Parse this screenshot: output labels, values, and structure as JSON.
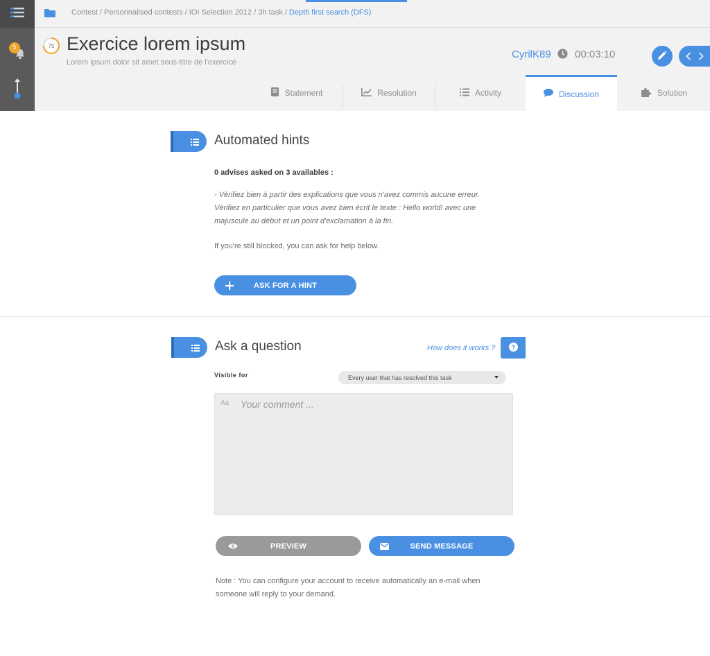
{
  "sidebar": {
    "notifications_count": "5"
  },
  "breadcrumb": {
    "items": [
      "Contest",
      "Personnalised contests",
      "IOI Selection 2012",
      "3h task"
    ],
    "current": "Depth first search (DFS)",
    "separator": "/"
  },
  "header": {
    "score": "75",
    "title": "Exercice lorem ipsum",
    "subtitle": "Lorem ipsum dolor sit amet sous-titre de l'exercice",
    "username": "CyrilK89",
    "timer": "00:03:10"
  },
  "tabs": [
    {
      "label": "Statement",
      "icon": "book-icon"
    },
    {
      "label": "Resolution",
      "icon": "chart-icon"
    },
    {
      "label": "Activity",
      "icon": "list-icon"
    },
    {
      "label": "Discussion",
      "icon": "comment-icon",
      "active": true
    },
    {
      "label": "Solution",
      "icon": "puzzle-icon"
    }
  ],
  "hints": {
    "title": "Automated hints",
    "count_line": "0 advises asked on 3 availables :",
    "hint_text": "- Vérifiez bien à partir des explications que vous n'avez commis aucune erreur. Vérifiez en particulier que vous avez bien écrit le texte : Hello world! avec une majuscule au début et un point d'exclamation à la fin.",
    "still_blocked": "If you're still blocked, you can ask for help below.",
    "ask_button": "ASK FOR A HINT"
  },
  "question": {
    "title": "Ask a question",
    "how_link": "How does it works ?",
    "visible_label": "Visible for",
    "visible_value": "Every user that has resolved this task",
    "editor_label": "Aa",
    "comment_placeholder": "Your comment ...",
    "preview_button": "PREVIEW",
    "send_button": "SEND MESSAGE",
    "note": "Note : You can configure your account to receive automatically an e-mail when someone will reply to your demand."
  },
  "colors": {
    "accent": "#4a90e2",
    "sidebar": "#5a5a5a",
    "badge": "#f0a52a",
    "score_ring": "#f0a52a"
  }
}
